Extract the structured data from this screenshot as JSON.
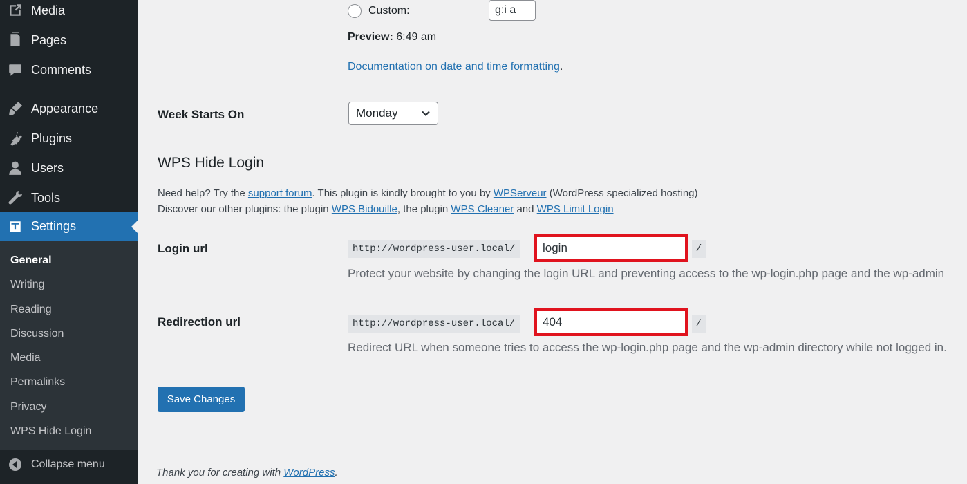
{
  "sidebar": {
    "menu": [
      {
        "label": "Media",
        "icon": "media-icon"
      },
      {
        "label": "Pages",
        "icon": "pages-icon"
      },
      {
        "label": "Comments",
        "icon": "comments-icon"
      },
      {
        "label": "Appearance",
        "icon": "appearance-icon"
      },
      {
        "label": "Plugins",
        "icon": "plugins-icon"
      },
      {
        "label": "Users",
        "icon": "users-icon"
      },
      {
        "label": "Tools",
        "icon": "tools-icon"
      },
      {
        "label": "Settings",
        "icon": "settings-icon"
      }
    ],
    "submenu": [
      "General",
      "Writing",
      "Reading",
      "Discussion",
      "Media",
      "Permalinks",
      "Privacy",
      "WPS Hide Login"
    ],
    "collapse_label": "Collapse menu"
  },
  "time_format": {
    "custom_label": "Custom:",
    "custom_value": "g:i a",
    "preview_label": "Preview:",
    "preview_value": "6:49 am",
    "doc_link": "Documentation on date and time formatting",
    "doc_suffix": "."
  },
  "week": {
    "label": "Week Starts On",
    "selected": "Monday"
  },
  "wps": {
    "title": "WPS Hide Login",
    "help1_pre": "Need help? Try the ",
    "help1_link1": "support forum",
    "help1_mid": ". This plugin is kindly brought to you by ",
    "help1_link2": "WPServeur",
    "help1_post": " (WordPress specialized hosting)",
    "help2_pre": "Discover our other plugins: the plugin ",
    "help2_link1": "WPS Bidouille",
    "help2_mid1": ", the plugin ",
    "help2_link2": "WPS Cleaner",
    "help2_mid2": " and ",
    "help2_link3": "WPS Limit Login",
    "login_label": "Login url",
    "login_prefix": "http://wordpress-user.local/",
    "login_value": "login",
    "login_suffix": "/",
    "login_desc": "Protect your website by changing the login URL and preventing access to the wp-login.php page and the wp-admin",
    "redirect_label": "Redirection url",
    "redirect_prefix": "http://wordpress-user.local/",
    "redirect_value": "404",
    "redirect_suffix": "/",
    "redirect_desc": "Redirect URL when someone tries to access the wp-login.php page and the wp-admin directory while not logged in."
  },
  "save_label": "Save Changes",
  "footer": {
    "pre": "Thank you for creating with ",
    "link": "WordPress",
    "post": "."
  },
  "colors": {
    "sidebar_bg": "#1d2327",
    "accent": "#2271b1",
    "highlight_border": "#e0131e"
  }
}
